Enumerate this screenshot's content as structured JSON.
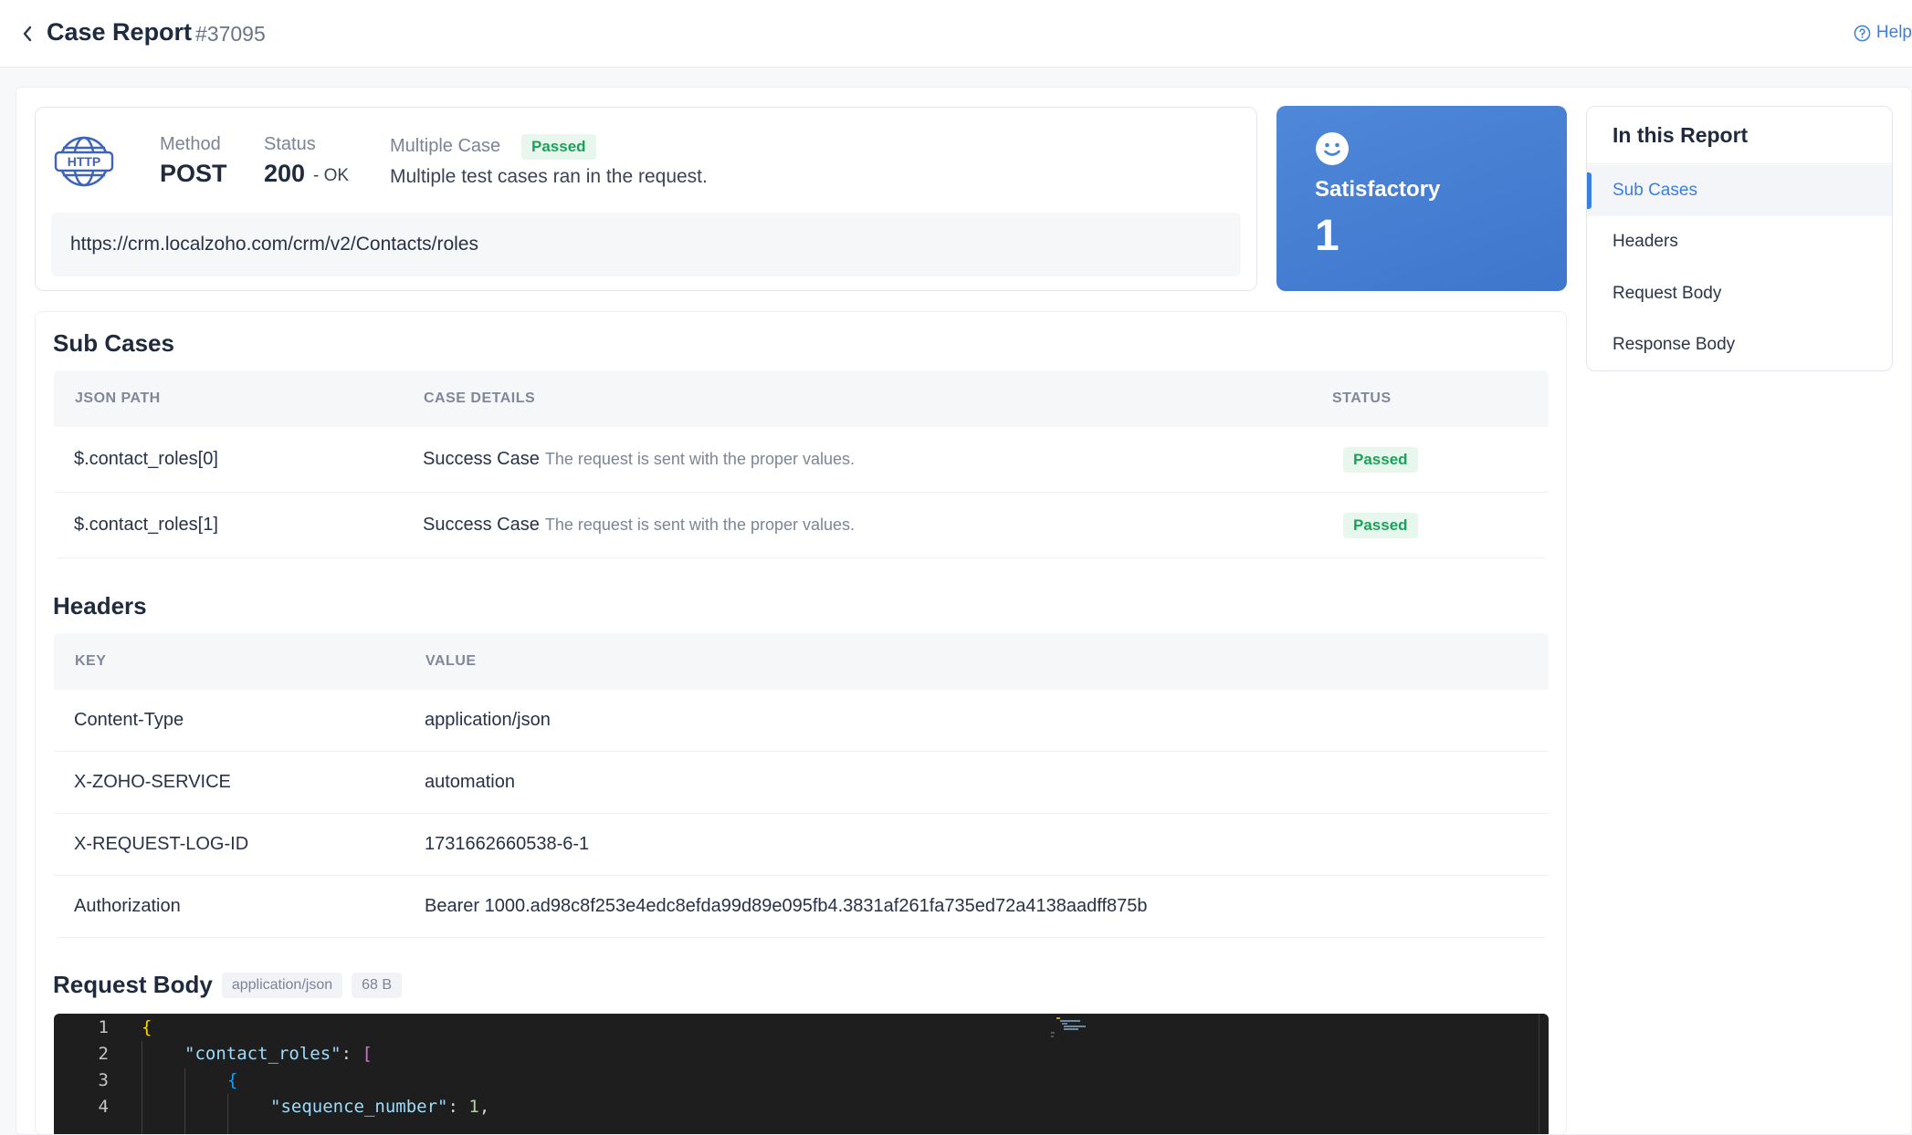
{
  "header": {
    "title": "Case Report",
    "case_id": "#37095",
    "help_label": "Help"
  },
  "summary": {
    "method_label": "Method",
    "method_value": "POST",
    "status_label": "Status",
    "status_code": "200",
    "status_text": "- OK",
    "multiple_case_label": "Multiple Case",
    "multiple_case_badge": "Passed",
    "multiple_case_desc": "Multiple test cases ran in the request.",
    "url": "https://crm.localzoho.com/crm/v2/Contacts/roles",
    "icon": "http-globe-icon"
  },
  "score": {
    "icon": "smiley-icon",
    "title": "Satisfactory",
    "value": "1"
  },
  "report_nav": {
    "title": "In this Report",
    "items": [
      {
        "label": "Sub Cases",
        "active": true
      },
      {
        "label": "Headers",
        "active": false
      },
      {
        "label": "Request Body",
        "active": false
      },
      {
        "label": "Response Body",
        "active": false
      }
    ]
  },
  "sub_cases": {
    "title": "Sub Cases",
    "columns": [
      "JSON PATH",
      "CASE DETAILS",
      "STATUS"
    ],
    "rows": [
      {
        "path": "$.contact_roles[0]",
        "case": "Success Case",
        "desc": "The request is sent with the proper values.",
        "status": "Passed"
      },
      {
        "path": "$.contact_roles[1]",
        "case": "Success Case",
        "desc": "The request is sent with the proper values.",
        "status": "Passed"
      }
    ]
  },
  "headers": {
    "title": "Headers",
    "columns": [
      "KEY",
      "VALUE"
    ],
    "rows": [
      {
        "key": "Content-Type",
        "value": "application/json"
      },
      {
        "key": "X-ZOHO-SERVICE",
        "value": "automation"
      },
      {
        "key": "X-REQUEST-LOG-ID",
        "value": "1731662660538-6-1"
      },
      {
        "key": "Authorization",
        "value": "Bearer 1000.ad98c8f253e4edc8efda99d89e095fb4.3831af261fa735ed72a4138aadff875b"
      }
    ]
  },
  "request_body": {
    "title": "Request Body",
    "content_type": "application/json",
    "size": "68 B",
    "lines": [
      {
        "n": "1",
        "text": "{"
      },
      {
        "n": "2",
        "key": "\"contact_roles\"",
        "rest": ": ",
        "bracket": "["
      },
      {
        "n": "3",
        "text": "{"
      },
      {
        "n": "4",
        "key": "\"sequence_number\"",
        "rest": ": ",
        "num": "1",
        "tail": ","
      }
    ]
  },
  "colors": {
    "accent": "#3b7fe0",
    "passed_text": "#1ea05a",
    "passed_bg": "#e8f7ee",
    "score_card": "#4a82d4"
  }
}
